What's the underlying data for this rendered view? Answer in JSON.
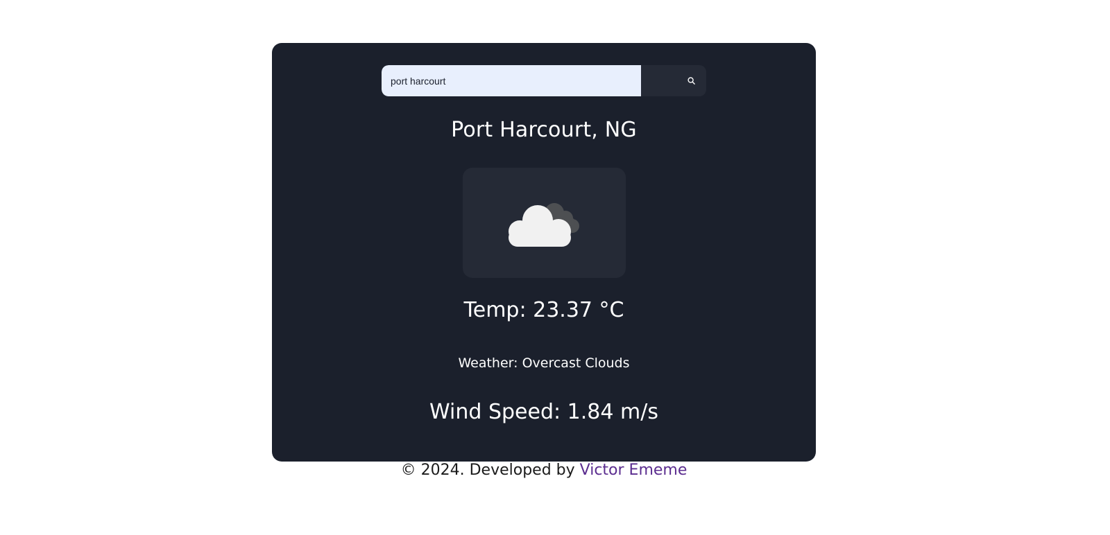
{
  "search": {
    "value": "port harcourt",
    "button_icon": "search-icon"
  },
  "location": {
    "name": "Port Harcourt, NG"
  },
  "weather_icon": "overcast-clouds-icon",
  "temperature": {
    "label": "Temp: 23.37 °C"
  },
  "condition": {
    "label": "Weather: Overcast Clouds"
  },
  "wind": {
    "label": "Wind Speed: 1.84 m/s"
  },
  "footer": {
    "prefix": "© 2024. Developed by ",
    "author": "Victor Ememe",
    "author_color": "#5b2d8f"
  },
  "colors": {
    "card_bg": "#1b202c",
    "panel_bg": "#252a36",
    "input_bg": "#e8effd",
    "text": "#ffffff"
  }
}
